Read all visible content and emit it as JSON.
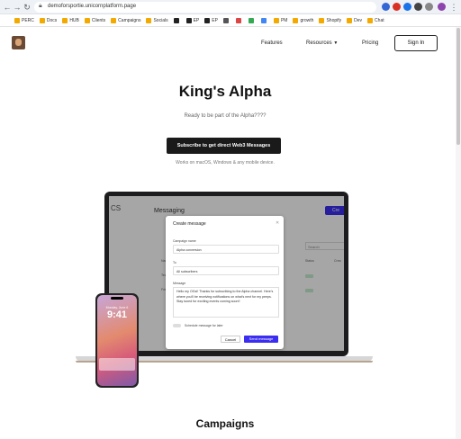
{
  "browser": {
    "url": "demoforsportie.unicornplatform.page",
    "bookmarks": [
      "PERC",
      "Docs",
      "HUB",
      "Clients",
      "Campaigns",
      "Socials",
      "EP",
      "EP",
      "PM",
      "growth",
      "Shopify",
      "Dev",
      "Chat"
    ]
  },
  "nav": {
    "features": "Features",
    "resources": "Resources",
    "pricing": "Pricing",
    "signin": "Sign In"
  },
  "hero": {
    "title": "King's Alpha",
    "subtitle": "Ready to be part of the Alpha????",
    "cta": "Subscribe to get direct Web3 Messages",
    "note": "Works on macOS, Windows & any mobile device."
  },
  "app": {
    "brand": "CS",
    "title": "Messaging",
    "button": "Cre",
    "search": "Search",
    "columns": [
      "Status",
      "Crea"
    ],
    "rows": [
      "Name",
      "Tea",
      "Frie"
    ],
    "modal": {
      "title": "Create message",
      "campaign_label": "Campaign name",
      "campaign_value": "Alpha conversion",
      "to_label": "To",
      "to_value": "All subscribers",
      "message_label": "Message",
      "message_value": "Hello my OGs!! Thanks for subscribing to the Alpha channel. Here's where you'll be receiving notifications on what's next for my peeps. Stay tuned for exciting events coming soon!!",
      "schedule_label": "Schedule message for later",
      "cancel": "Cancel",
      "send": "Send message"
    }
  },
  "phone": {
    "date": "Monday, June 6",
    "time": "9:41"
  },
  "section": {
    "title": "Campaigns"
  },
  "colors": {
    "accent": "#3b2ef0",
    "dark": "#1a1a1a"
  }
}
